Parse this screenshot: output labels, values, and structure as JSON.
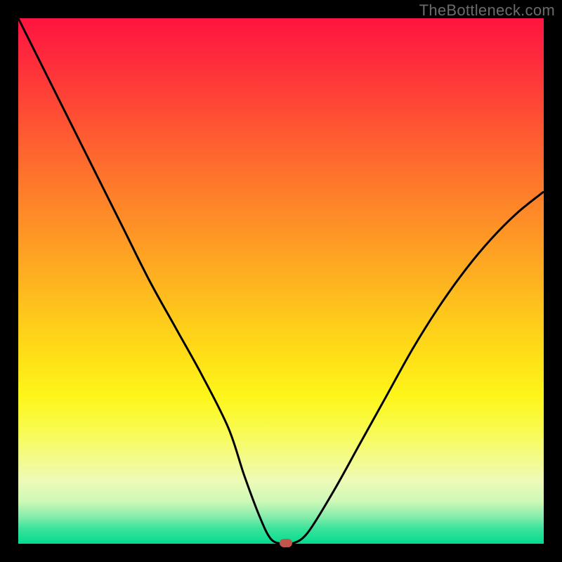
{
  "watermark": "TheBottleneck.com",
  "colors": {
    "frame": "#000000",
    "gradient_top": "#fe1440",
    "gradient_bottom": "#03dc8e",
    "curve": "#000000",
    "marker": "#c1564d"
  },
  "chart_data": {
    "type": "line",
    "title": "",
    "xlabel": "",
    "ylabel": "",
    "xlim": [
      0,
      100
    ],
    "ylim": [
      0,
      100
    ],
    "x": [
      0,
      5,
      10,
      15,
      20,
      25,
      30,
      35,
      40,
      43,
      46,
      48,
      50,
      52,
      55,
      60,
      65,
      70,
      75,
      80,
      85,
      90,
      95,
      100
    ],
    "values": [
      100,
      90,
      80,
      70,
      60,
      50,
      41,
      32,
      22,
      13,
      5,
      1,
      0,
      0,
      2,
      10,
      19,
      28,
      37,
      45,
      52,
      58,
      63,
      67
    ],
    "marker": {
      "x": 51,
      "y": 0
    },
    "note": "V-shaped bottleneck curve; minimum near x≈50 where error ≈ 0. Background gradient encodes error: red=high, green=low."
  }
}
